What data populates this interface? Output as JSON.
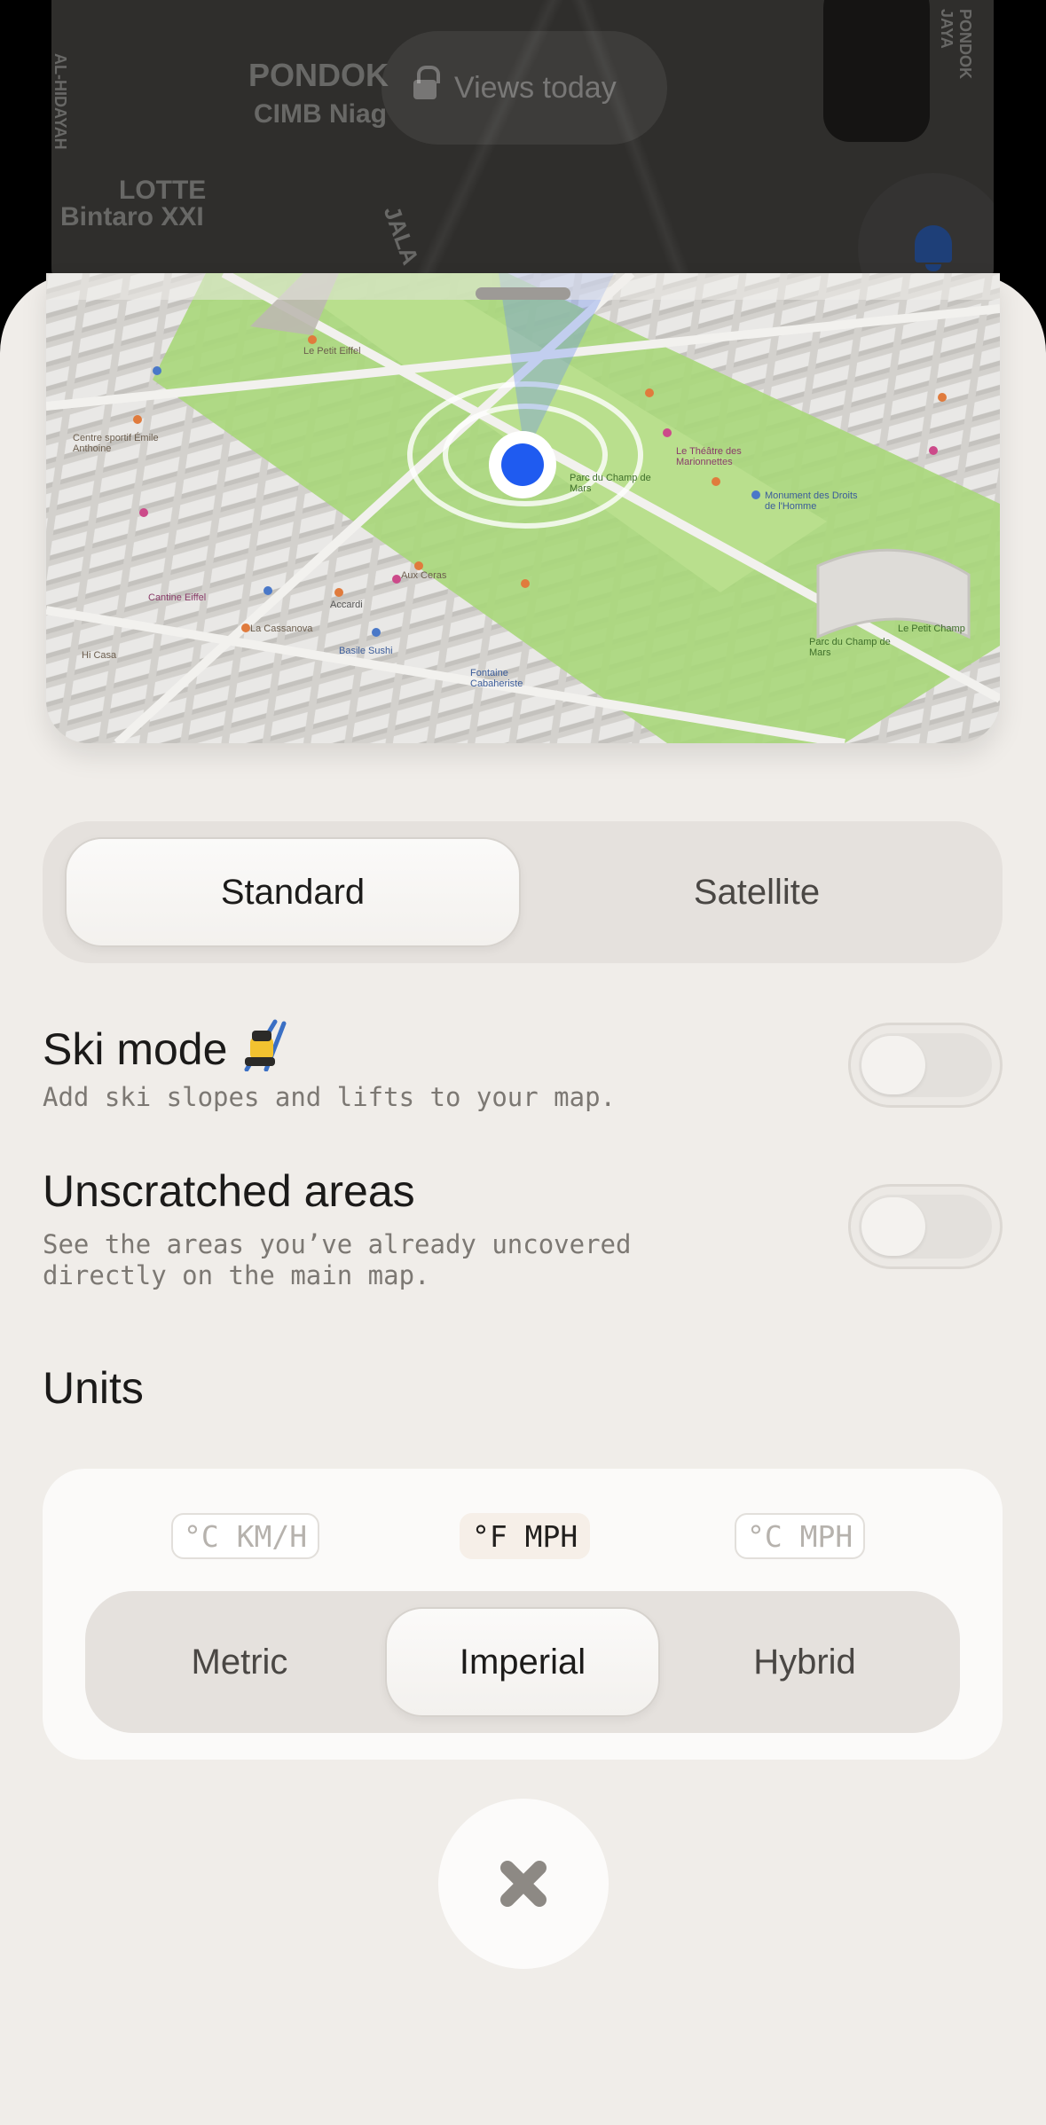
{
  "background_app": {
    "labels": [
      "PONDOK",
      "CIMB Niag",
      "LOTTE",
      "Bintaro XXI",
      "AL-HIDAYAH",
      "JALA",
      "PONDOK JAYA"
    ],
    "views_pill": "Views today"
  },
  "map_preview": {
    "place_labels": [
      "Le Petit Eiffel",
      "Centre sportif Émile Anthoine",
      "Parc du Champ de Mars",
      "Le Théâtre des Marionnettes",
      "Monument des Droits de l'Homme",
      "Accardi",
      "Aux Ceras",
      "Basile Sushi",
      "Fontaine Cabaheriste",
      "La Cassanova",
      "Hi Casa",
      "Cantine Eiffel",
      "Parc du Champ de Mars",
      "Le Petit Champ"
    ]
  },
  "map_style": {
    "options": [
      "Standard",
      "Satellite"
    ],
    "selected": "Standard"
  },
  "ski_mode": {
    "title": "Ski mode",
    "description": "Add ski slopes and lifts to your map.",
    "enabled": false
  },
  "unscratched": {
    "title": "Unscratched areas",
    "description": "See the areas you’ve already uncovered directly on the main map.",
    "enabled": false
  },
  "units": {
    "heading": "Units",
    "previews": [
      "°C KM/H",
      "°F MPH",
      "°C MPH"
    ],
    "options": [
      "Metric",
      "Imperial",
      "Hybrid"
    ],
    "selected": "Imperial"
  },
  "colors": {
    "sheet_bg": "#f0ede9",
    "location_dot": "#1f5bf0",
    "park_green": "#a9d77a"
  },
  "icons": {
    "close": "close-x-icon",
    "ski": "skier-emoji-icon",
    "bell": "bell-icon",
    "lock": "lock-icon"
  }
}
